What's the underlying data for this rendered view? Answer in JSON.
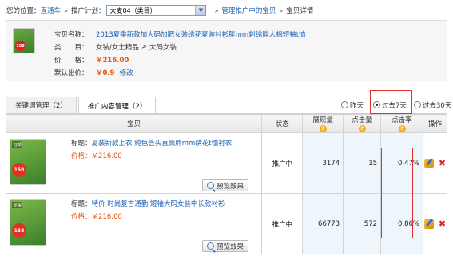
{
  "breadcrumb": {
    "location_label": "您的位置：",
    "home": "直通车",
    "plan_label": "推广计划：",
    "plan_value": "大麦04（类目）",
    "managing": "管理推广中的宝贝",
    "current": "宝贝详情",
    "separator": "»"
  },
  "product": {
    "thumb_badge": "158",
    "name_label": "宝贝名称：",
    "name": "2013夏季新款加大码加肥女装绣花夏装衬衫胖mm刺绣胖人棉短袖t恤",
    "category_label": "类　　目：",
    "category_1": "女装/女士精品",
    "category_sep": ">",
    "category_2": "大码女装",
    "price_label": "价　　格：",
    "price": "￥216.00",
    "default_bid_label": "默认出价：",
    "default_bid": "￥0.9",
    "edit": "修改"
  },
  "tabs": [
    {
      "label": "关键词管理（2）",
      "active": false
    },
    {
      "label": "推广内容管理（2）",
      "active": true
    }
  ],
  "periods": [
    {
      "label": "昨天",
      "checked": false
    },
    {
      "label": "过去7天",
      "checked": true
    },
    {
      "label": "过去30天",
      "checked": false
    }
  ],
  "table": {
    "columns": [
      "宝贝",
      "状态",
      "展现量",
      "点击量",
      "点击率",
      "操作"
    ],
    "help_icon": "?",
    "rows": [
      {
        "thumb_badge": "158",
        "thumb_brand": "包邮",
        "title_label": "标题：",
        "title": "夏装新款上衣 纯色荟头直筒胖mm绣花t恤衬衣",
        "price_label": "价格：",
        "price": "￥216.00",
        "preview": "预览效果",
        "status": "推广中",
        "impressions": "3174",
        "clicks": "15",
        "ctr": "0.47%"
      },
      {
        "thumb_badge": "158",
        "thumb_brand": "显瘦",
        "title_label": "标题：",
        "title": "特价 时尚复古通勤 短袖大码女装中长款衬衫",
        "price_label": "价格：",
        "price": "￥216.00",
        "preview": "预览效果",
        "status": "推广中",
        "impressions": "66773",
        "clicks": "572",
        "ctr": "0.86%"
      }
    ]
  },
  "colors": {
    "link": "#1a5fb4",
    "price": "#e8530e",
    "highlight_border": "#e03030"
  }
}
